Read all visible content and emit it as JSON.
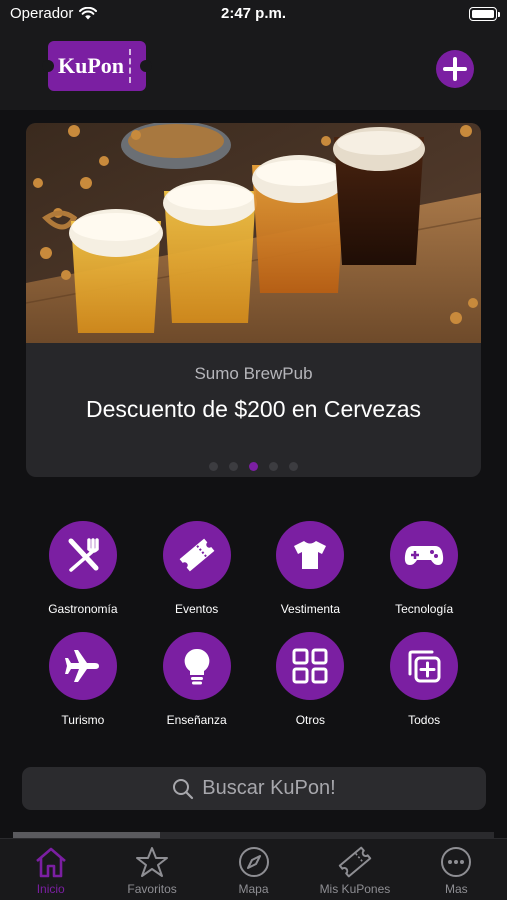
{
  "status_bar": {
    "carrier": "Operador",
    "time": "2:47 p.m."
  },
  "header": {
    "logo_text": "KuPon"
  },
  "featured": {
    "business": "Sumo BrewPub",
    "title": "Descuento de $200 en Cervezas",
    "pages": 5,
    "active_page": 3
  },
  "categories": [
    {
      "label": "Gastronomía",
      "icon": "utensils-icon"
    },
    {
      "label": "Eventos",
      "icon": "ticket-icon"
    },
    {
      "label": "Vestimenta",
      "icon": "tshirt-icon"
    },
    {
      "label": "Tecnología",
      "icon": "gamepad-icon"
    },
    {
      "label": "Turismo",
      "icon": "airplane-icon"
    },
    {
      "label": "Enseñanza",
      "icon": "lightbulb-icon"
    },
    {
      "label": "Otros",
      "icon": "grid-icon"
    },
    {
      "label": "Todos",
      "icon": "stack-plus-icon"
    }
  ],
  "search": {
    "placeholder": "Buscar KuPon!"
  },
  "tabs": [
    {
      "label": "Inicio",
      "icon": "home-icon",
      "active": true
    },
    {
      "label": "Favoritos",
      "icon": "star-icon",
      "active": false
    },
    {
      "label": "Mapa",
      "icon": "compass-icon",
      "active": false
    },
    {
      "label": "Mis KuPones",
      "icon": "ticket-icon",
      "active": false
    },
    {
      "label": "Mas",
      "icon": "more-icon",
      "active": false
    }
  ],
  "colors": {
    "accent": "#7b1fa2",
    "background": "#111113",
    "card": "#27272a"
  }
}
